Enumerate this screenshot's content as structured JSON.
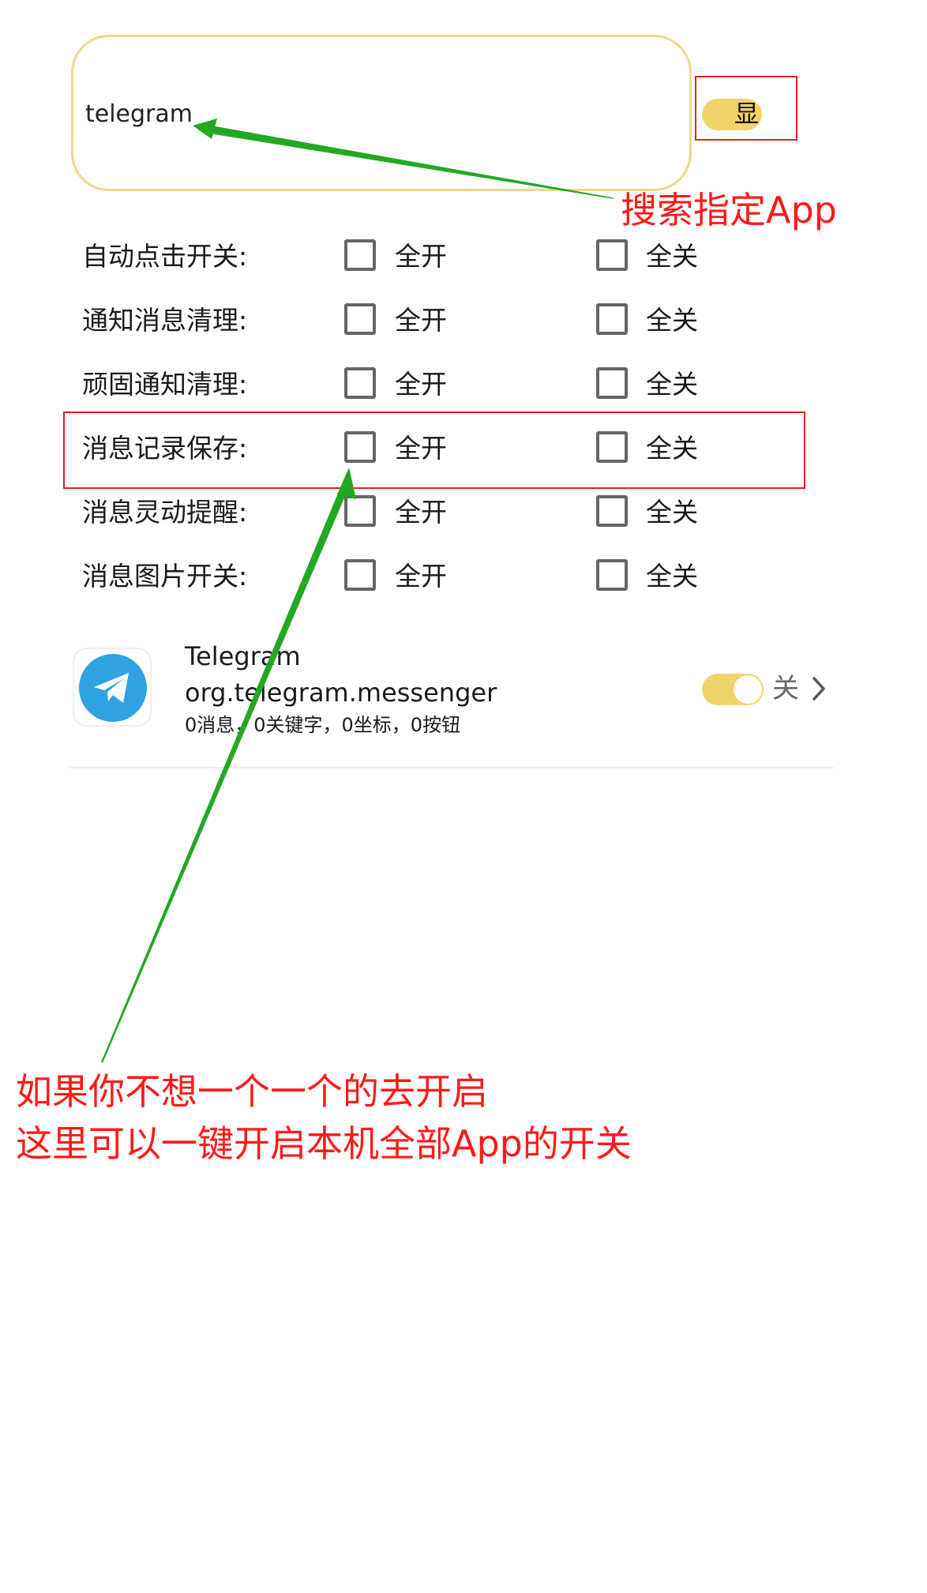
{
  "search": {
    "value": "telegram"
  },
  "show_toggle": {
    "label": "显",
    "on": true
  },
  "annotations": {
    "search_note": "搜索指定App",
    "bulk_note_line1": "如果你不想一个一个的去开启",
    "bulk_note_line2": "这里可以一键开启本机全部App的开关"
  },
  "bulk": {
    "on_label": "全开",
    "off_label": "全关",
    "rows": [
      {
        "label": "自动点击开关:",
        "on_checked": false,
        "off_checked": false
      },
      {
        "label": "通知消息清理:",
        "on_checked": false,
        "off_checked": false
      },
      {
        "label": "顽固通知清理:",
        "on_checked": false,
        "off_checked": false
      },
      {
        "label": "消息记录保存:",
        "on_checked": false,
        "off_checked": false
      },
      {
        "label": "消息灵动提醒:",
        "on_checked": false,
        "off_checked": false
      },
      {
        "label": "消息图片开关:",
        "on_checked": false,
        "off_checked": false
      }
    ]
  },
  "app": {
    "name": "Telegram",
    "package": "org.telegram.messenger",
    "stats": "0消息，0关键字，0坐标，0按钮",
    "toggle_on": true,
    "toggle_label": "关",
    "icon": "telegram-logo-icon",
    "icon_color": "#2fa3df"
  },
  "colors": {
    "accent_yellow": "#f2d36b",
    "annotation_red": "#ff1a1a",
    "arrow_green": "#22a822"
  }
}
